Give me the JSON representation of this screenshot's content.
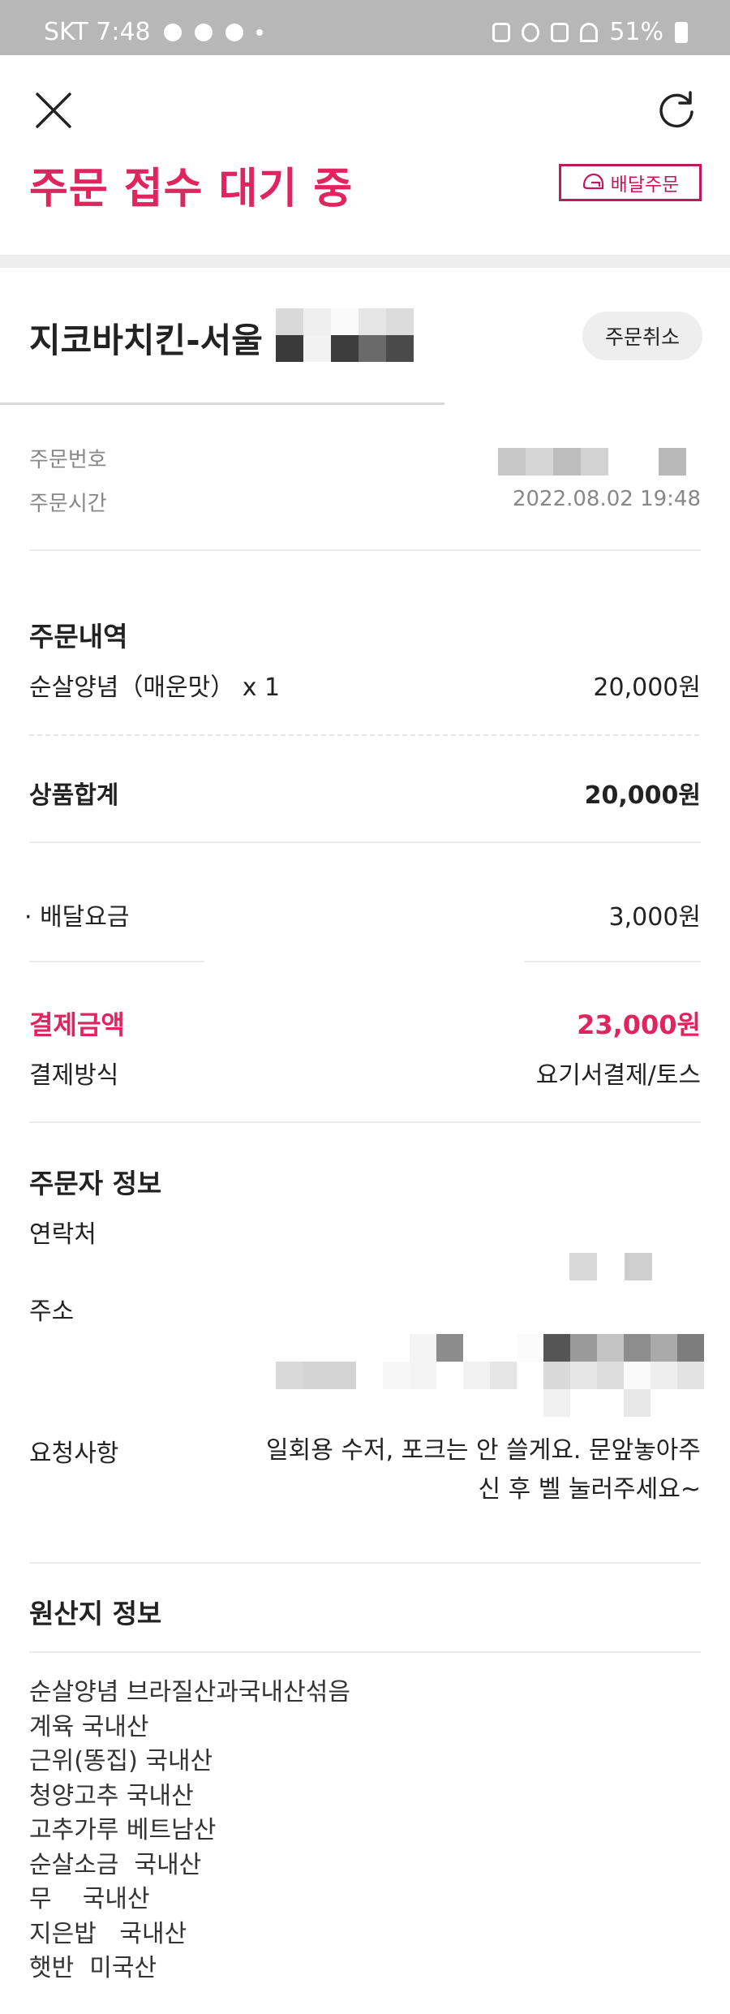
{
  "status_bar": {
    "carrier_time": "SKT 7:48",
    "battery": "51%"
  },
  "header": {
    "status_title": "주문 접수 대기 중",
    "delivery_badge": "배달주문",
    "close_icon": "close-icon",
    "refresh_icon": "refresh-icon"
  },
  "store": {
    "name": "지코바치킨-서울",
    "cancel_label": "주문취소"
  },
  "order": {
    "number_label": "주문번호",
    "time_label": "주문시간",
    "time_value": "2022.08.02 19:48"
  },
  "items": {
    "title": "주문내역",
    "list": [
      {
        "name": "순살양념（매운맛） x 1",
        "price": "20,000원"
      }
    ]
  },
  "totals": {
    "subtotal_label": "상품합계",
    "subtotal_value": "20,000원",
    "delivery_label": "· 배달요금",
    "delivery_value": "3,000원",
    "payment_label": "결제금액",
    "payment_value": "23,000원",
    "method_label": "결제방식",
    "method_value": "요기서결제/토스"
  },
  "orderer": {
    "title": "주문자 정보",
    "contact_label": "연락처",
    "address_label": "주소",
    "request_label": "요청사항",
    "request_value": "일회용 수저, 포크는 안 쓸게요. 문앞놓아주신 후 벨 눌러주세요~"
  },
  "origin": {
    "title": "원산지 정보",
    "lines": [
      "순살양념 브라질산과국내산섞음",
      "계육 국내산",
      "근위(똥집) 국내산",
      "청양고추 국내산",
      "고추가루 베트남산",
      "순살소금  국내산",
      "무    국내산",
      "지은밥   국내산",
      "햇반  미국산"
    ]
  },
  "colors": {
    "accent": "#e0245e",
    "badge_border": "#c2185b",
    "status_bar_bg": "#b7b7b7",
    "band_bg": "#eeeeee"
  }
}
